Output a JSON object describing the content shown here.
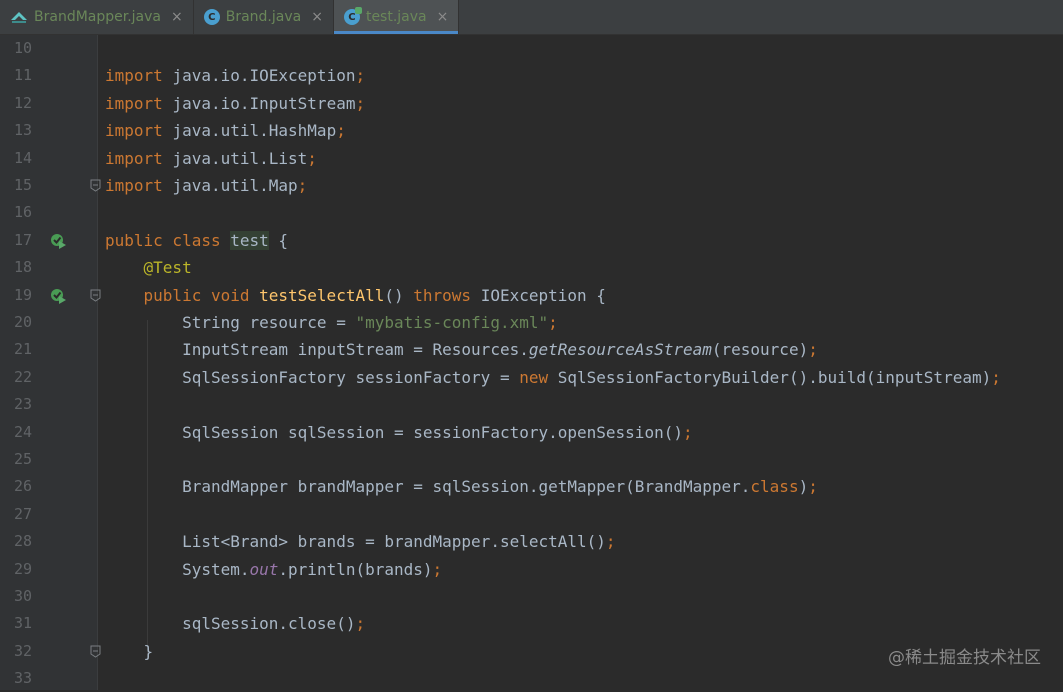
{
  "tabs": [
    {
      "label": "BrandMapper.java",
      "icon": "mapper-interface-icon"
    },
    {
      "label": "Brand.java",
      "icon": "java-class-icon"
    },
    {
      "label": "test.java",
      "icon": "java-test-class-icon",
      "active": true
    }
  ],
  "close_glyph": "×",
  "lines": [
    {
      "n": "10"
    },
    {
      "n": "11",
      "t": [
        [
          "kw",
          "import "
        ],
        [
          "",
          "java.io.IOException"
        ],
        [
          "kw",
          ";"
        ]
      ]
    },
    {
      "n": "12",
      "t": [
        [
          "kw",
          "import "
        ],
        [
          "",
          "java.io.InputStream"
        ],
        [
          "kw",
          ";"
        ]
      ]
    },
    {
      "n": "13",
      "t": [
        [
          "kw",
          "import "
        ],
        [
          "",
          "java.util.HashMap"
        ],
        [
          "kw",
          ";"
        ]
      ]
    },
    {
      "n": "14",
      "t": [
        [
          "kw",
          "import "
        ],
        [
          "",
          "java.util.List"
        ],
        [
          "kw",
          ";"
        ]
      ]
    },
    {
      "n": "15",
      "t": [
        [
          "kw",
          "import "
        ],
        [
          "",
          "java.util.Map"
        ],
        [
          "kw",
          ";"
        ]
      ],
      "fold": true
    },
    {
      "n": "16"
    },
    {
      "n": "17",
      "run": true,
      "t": [
        [
          "kw",
          "public class "
        ],
        [
          "hl",
          "test"
        ],
        [
          "",
          " {"
        ]
      ]
    },
    {
      "n": "18",
      "t": [
        [
          "",
          "    "
        ],
        [
          "ann",
          "@Test"
        ]
      ]
    },
    {
      "n": "19",
      "run": true,
      "fold": true,
      "t": [
        [
          "",
          "    "
        ],
        [
          "kw",
          "public void "
        ],
        [
          "fn",
          "testSelectAll"
        ],
        [
          "",
          "() "
        ],
        [
          "kw",
          "throws "
        ],
        [
          "",
          "IOException {"
        ]
      ]
    },
    {
      "n": "20",
      "t": [
        [
          "",
          "        String resource = "
        ],
        [
          "str",
          "\"mybatis-config.xml\""
        ],
        [
          "kw",
          ";"
        ]
      ]
    },
    {
      "n": "21",
      "t": [
        [
          "",
          "        InputStream inputStream = Resources."
        ],
        [
          "it",
          "getResourceAsStream"
        ],
        [
          "",
          "(resource)"
        ],
        [
          "kw",
          ";"
        ]
      ]
    },
    {
      "n": "22",
      "t": [
        [
          "",
          "        SqlSessionFactory sessionFactory = "
        ],
        [
          "kw",
          "new "
        ],
        [
          "",
          "SqlSessionFactoryBuilder().build(inputStream)"
        ],
        [
          "kw",
          ";"
        ]
      ]
    },
    {
      "n": "23"
    },
    {
      "n": "24",
      "t": [
        [
          "",
          "        SqlSession sqlSession = sessionFactory.openSession()"
        ],
        [
          "kw",
          ";"
        ]
      ]
    },
    {
      "n": "25"
    },
    {
      "n": "26",
      "t": [
        [
          "",
          "        BrandMapper brandMapper = sqlSession.getMapper(BrandMapper."
        ],
        [
          "kw",
          "class"
        ],
        [
          "",
          ")"
        ],
        [
          "kw",
          ";"
        ]
      ]
    },
    {
      "n": "27"
    },
    {
      "n": "28",
      "t": [
        [
          "",
          "        List<Brand> brands = brandMapper.selectAll()"
        ],
        [
          "kw",
          ";"
        ]
      ]
    },
    {
      "n": "29",
      "t": [
        [
          "",
          "        System."
        ],
        [
          "stat",
          "out"
        ],
        [
          "",
          ".println(brands)"
        ],
        [
          "kw",
          ";"
        ]
      ]
    },
    {
      "n": "30"
    },
    {
      "n": "31",
      "t": [
        [
          "",
          "        sqlSession.close()"
        ],
        [
          "kw",
          ";"
        ]
      ]
    },
    {
      "n": "32",
      "fold": true,
      "t": [
        [
          "",
          "    }"
        ]
      ]
    },
    {
      "n": "33"
    }
  ],
  "watermark": "@稀土掘金技术社区"
}
